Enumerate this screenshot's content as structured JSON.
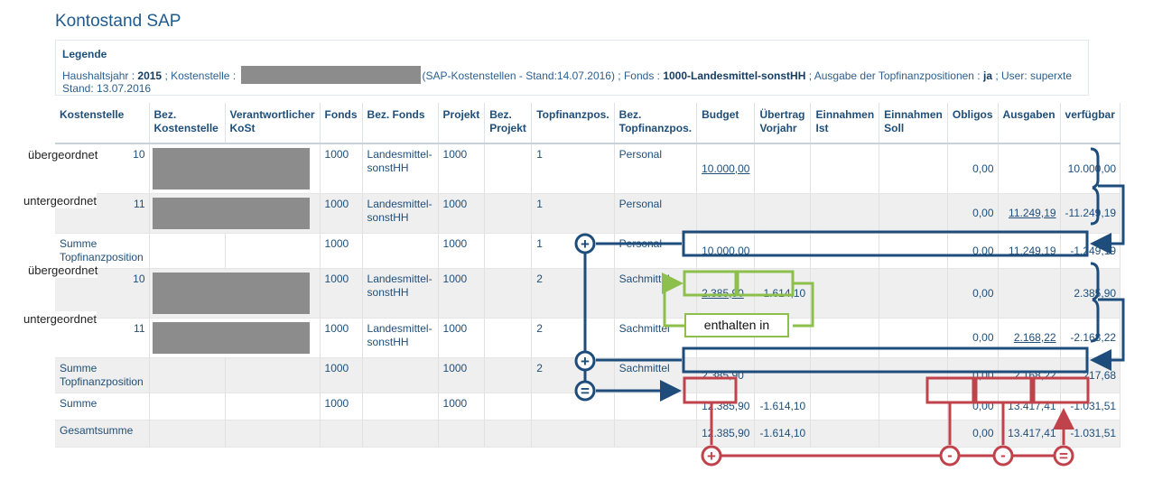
{
  "title": "Kontostand SAP",
  "legend": {
    "heading": "Legende",
    "label_year": "Haushaltsjahr :",
    "year": "2015",
    "label_cost_center": "; Kostenstelle :",
    "sap_note": "(SAP-Kostenstellen - Stand:14.07.2016) ; Fonds :",
    "fonds": "1000-Landesmittel-sonstHH",
    "label_output": "; Ausgabe der Topfinanzpositionen :",
    "output": "ja",
    "user": "; User: superxte",
    "stand": "Stand: 13.07.2016"
  },
  "columns": [
    "Kostenstelle",
    "Bez. Kostenstelle",
    "Verantwortlicher KoSt",
    "Fonds",
    "Bez. Fonds",
    "Projekt",
    "Bez. Projekt",
    "Topfinanzpos.",
    "Bez. Topfinanzpos.",
    "Budget",
    "Übertrag Vorjahr",
    "Einnahmen Ist",
    "Einnahmen Soll",
    "Obligos",
    "Ausgaben",
    "verfügbar"
  ],
  "rows": [
    {
      "kst": "10",
      "fonds": "1000",
      "bez_fonds": "Landesmittel-sonstHH",
      "projekt": "1000",
      "topf": "1",
      "bez_topf": "Personal",
      "budget": "10.000,00",
      "uebertrag": "",
      "obligo": "0,00",
      "ausgaben": "",
      "verfuegbar": "10.000,00"
    },
    {
      "kst": "11",
      "fonds": "1000",
      "bez_fonds": "Landesmittel-sonstHH",
      "projekt": "1000",
      "topf": "1",
      "bez_topf": "Personal",
      "budget": "",
      "uebertrag": "",
      "obligo": "0,00",
      "ausgaben": "11.249,19",
      "verfuegbar": "-11.249,19"
    },
    {
      "kst": "Summe Topfinanzposition",
      "fonds": "1000",
      "bez_fonds": "",
      "projekt": "1000",
      "topf": "1",
      "bez_topf": "Personal",
      "budget": "10.000,00",
      "uebertrag": "",
      "obligo": "0,00",
      "ausgaben": "11.249,19",
      "verfuegbar": "-1.249,19"
    },
    {
      "kst": "10",
      "fonds": "1000",
      "bez_fonds": "Landesmittel-sonstHH",
      "projekt": "1000",
      "topf": "2",
      "bez_topf": "Sachmittel",
      "budget": "2.385,90",
      "uebertrag": "-1.614,10",
      "obligo": "0,00",
      "ausgaben": "",
      "verfuegbar": "2.385,90"
    },
    {
      "kst": "11",
      "fonds": "1000",
      "bez_fonds": "Landesmittel-sonstHH",
      "projekt": "1000",
      "topf": "2",
      "bez_topf": "Sachmittel",
      "budget": "",
      "uebertrag": "",
      "obligo": "0,00",
      "ausgaben": "2.168,22",
      "verfuegbar": "-2.168,22"
    },
    {
      "kst": "Summe Topfinanzposition",
      "fonds": "1000",
      "bez_fonds": "",
      "projekt": "1000",
      "topf": "2",
      "bez_topf": "Sachmittel",
      "budget": "2.385,90",
      "uebertrag": "",
      "obligo": "0,00",
      "ausgaben": "2.168,22",
      "verfuegbar": "217,68"
    },
    {
      "kst": "Summe",
      "fonds": "1000",
      "bez_fonds": "",
      "projekt": "1000",
      "topf": "",
      "bez_topf": "",
      "budget": "12.385,90",
      "uebertrag": "-1.614,10",
      "obligo": "0,00",
      "ausgaben": "13.417,41",
      "verfuegbar": "-1.031,51"
    },
    {
      "kst": "Gesamtsumme",
      "fonds": "",
      "bez_fonds": "",
      "projekt": "",
      "topf": "",
      "bez_topf": "",
      "budget": "12.385,90",
      "uebertrag": "-1.614,10",
      "obligo": "0,00",
      "ausgaben": "13.417,41",
      "verfuegbar": "-1.031,51"
    }
  ],
  "annotations": {
    "parent_label": "übergeordnet",
    "child_label": "untergeordnet",
    "contained_in": "enthalten in",
    "plus": "+",
    "minus": "-",
    "equals": "=",
    "colors": {
      "blue": "#1e4d7b",
      "green": "#8cbf4b",
      "red": "#c0424a",
      "redact": "#8c8c8c"
    }
  }
}
